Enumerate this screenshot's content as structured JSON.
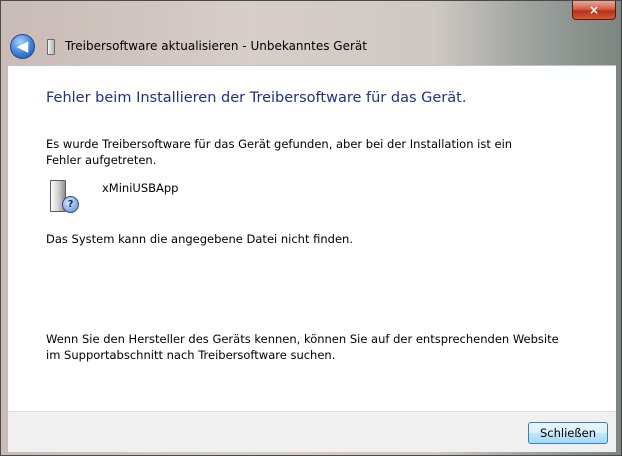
{
  "window": {
    "close_glyph": "×"
  },
  "nav": {
    "back_glyph": "◀",
    "title": "Treibersoftware aktualisieren - Unbekanntes Gerät"
  },
  "content": {
    "heading": "Fehler beim Installieren der Treibersoftware für das Gerät.",
    "message": "Es wurde Treibersoftware für das Gerät gefunden, aber bei der Installation ist ein Fehler aufgetreten.",
    "device_icon": "unknown-device-icon",
    "question_glyph": "?",
    "device_name": "xMiniUSBApp",
    "error_detail": "Das System kann die angegebene Datei nicht finden.",
    "hint": "Wenn Sie den Hersteller des Geräts kennen, können Sie auf der entsprechenden Website im Supportabschnitt nach Treibersoftware suchen."
  },
  "footer": {
    "close_label": "Schließen"
  },
  "colors": {
    "heading": "#1e3287",
    "close_red": "#c7442a",
    "button_border": "#3c7fb1"
  }
}
